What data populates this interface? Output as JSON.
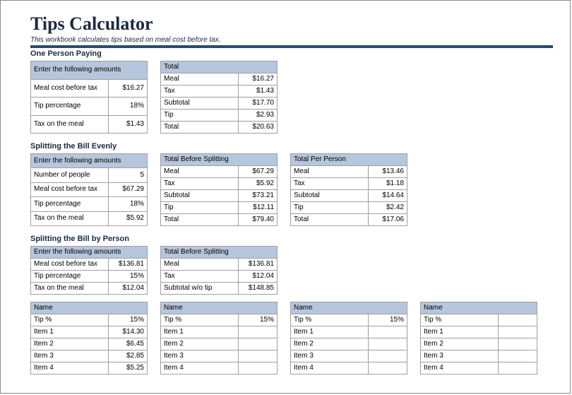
{
  "title": "Tips Calculator",
  "subtitle": "This workbook calculates tips based on meal cost before tax.",
  "section1": {
    "title": "One Person Paying",
    "input_header": "Enter the following amounts",
    "rows": [
      {
        "label": "Meal cost before tax",
        "value": "$16.27"
      },
      {
        "label": "Tip percentage",
        "value": "18%"
      },
      {
        "label": "Tax on the meal",
        "value": "$1.43"
      }
    ],
    "total_header": "Total",
    "totals": [
      {
        "label": "Meal",
        "value": "$16.27"
      },
      {
        "label": "Tax",
        "value": "$1.43"
      },
      {
        "label": "Subtotal",
        "value": "$17.70"
      },
      {
        "label": "Tip",
        "value": "$2.93"
      },
      {
        "label": "Total",
        "value": "$20.63"
      }
    ]
  },
  "section2": {
    "title": "Splitting the Bill Evenly",
    "input_header": "Enter the following amounts",
    "rows": [
      {
        "label": "Number of people",
        "value": "5"
      },
      {
        "label": "Meal cost before tax",
        "value": "$67.29"
      },
      {
        "label": "Tip percentage",
        "value": "18%"
      },
      {
        "label": "Tax on the meal",
        "value": "$5.92"
      }
    ],
    "before_header": "Total Before Splitting",
    "before": [
      {
        "label": "Meal",
        "value": "$67.29"
      },
      {
        "label": "Tax",
        "value": "$5.92"
      },
      {
        "label": "Subtotal",
        "value": "$73.21"
      },
      {
        "label": "Tip",
        "value": "$12.11"
      },
      {
        "label": "Total",
        "value": "$79.40"
      }
    ],
    "per_header": "Total Per Person",
    "per": [
      {
        "label": "Meal",
        "value": "$13.46"
      },
      {
        "label": "Tax",
        "value": "$1.18"
      },
      {
        "label": "Subtotal",
        "value": "$14.64"
      },
      {
        "label": "Tip",
        "value": "$2.42"
      },
      {
        "label": "Total",
        "value": "$17.06"
      }
    ]
  },
  "section3": {
    "title": "Splitting the Bill by Person",
    "input_header": "Enter the following amounts",
    "rows": [
      {
        "label": "Meal cost before tax",
        "value": "$136.81"
      },
      {
        "label": "Tip percentage",
        "value": "15%"
      },
      {
        "label": "Tax on the meal",
        "value": "$12.04"
      }
    ],
    "before_header": "Total Before Splitting",
    "before": [
      {
        "label": "Meal",
        "value": "$136.81"
      },
      {
        "label": "Tax",
        "value": "$12.04"
      },
      {
        "label": "Subtotal w/o tip",
        "value": "$148.85"
      }
    ],
    "names_header": "Name",
    "tip_label": "Tip %",
    "item_labels": [
      "Item 1",
      "Item 2",
      "Item 3",
      "Item 4"
    ],
    "persons": [
      {
        "tip": "15%",
        "items": [
          "$14.30",
          "$6.45",
          "$2.85",
          "$5.25"
        ]
      },
      {
        "tip": "15%",
        "items": [
          "",
          "",
          "",
          ""
        ]
      },
      {
        "tip": "15%",
        "items": [
          "",
          "",
          "",
          ""
        ]
      },
      {
        "tip": "",
        "items": [
          "",
          "",
          "",
          ""
        ]
      }
    ]
  }
}
